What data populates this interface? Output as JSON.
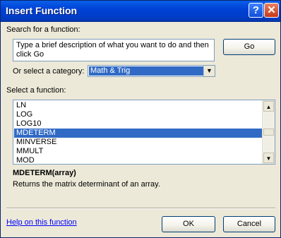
{
  "window": {
    "title": "Insert Function",
    "help_glyph": "?",
    "close_glyph": "✕"
  },
  "search": {
    "label": "Search for a function:",
    "value": "Type a brief description of what you want to do and then click Go",
    "go_label": "Go"
  },
  "category": {
    "label": "Or select a category:",
    "selected": "Math & Trig"
  },
  "functions": {
    "label": "Select a function:",
    "items": [
      "LN",
      "LOG",
      "LOG10",
      "MDETERM",
      "MINVERSE",
      "MMULT",
      "MOD"
    ],
    "selected": "MDETERM"
  },
  "details": {
    "syntax": "MDETERM(array)",
    "description": "Returns the matrix determinant of an array."
  },
  "footer": {
    "help_link": "Help on this function",
    "ok_label": "OK",
    "cancel_label": "Cancel"
  }
}
